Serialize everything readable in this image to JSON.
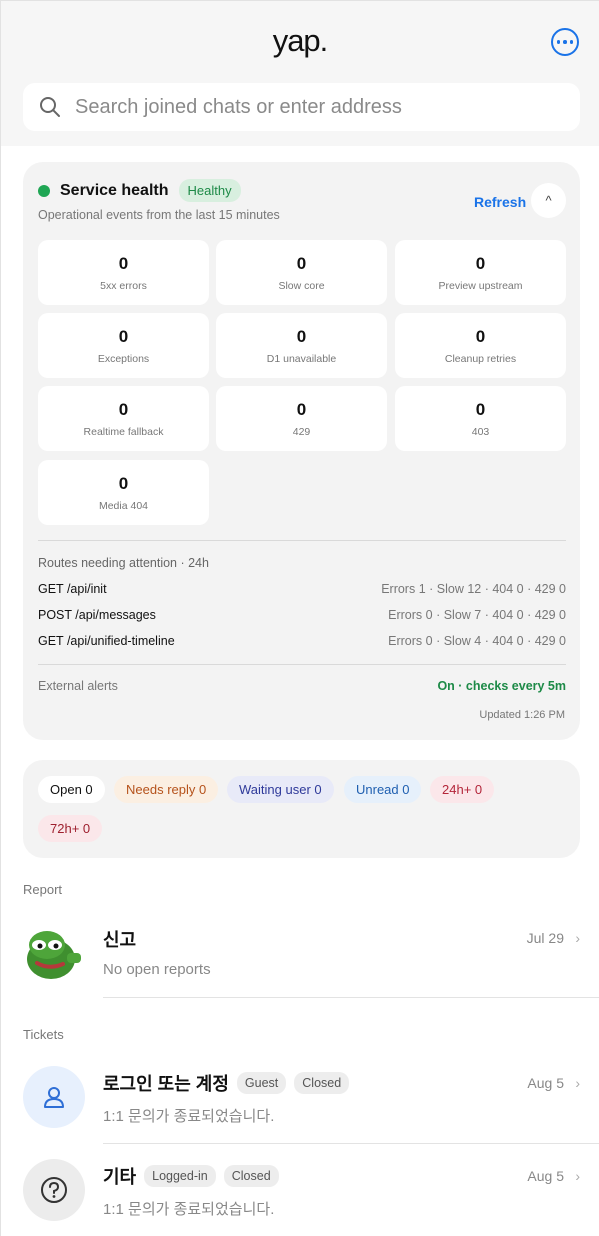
{
  "header": {
    "logo": "yap.",
    "search_placeholder": "Search joined chats or enter address"
  },
  "health": {
    "title": "Service health",
    "status_badge": "Healthy",
    "subtitle": "Operational events from the last 15 minutes",
    "refresh_label": "Refresh",
    "collapse_glyph": "^",
    "metrics": [
      {
        "value": "0",
        "label": "5xx errors"
      },
      {
        "value": "0",
        "label": "Slow core"
      },
      {
        "value": "0",
        "label": "Preview upstream"
      },
      {
        "value": "0",
        "label": "Exceptions"
      },
      {
        "value": "0",
        "label": "D1 unavailable"
      },
      {
        "value": "0",
        "label": "Cleanup retries"
      },
      {
        "value": "0",
        "label": "Realtime fallback"
      },
      {
        "value": "0",
        "label": "429"
      },
      {
        "value": "0",
        "label": "403"
      },
      {
        "value": "0",
        "label": "Media 404"
      }
    ],
    "routes_title": "Routes needing attention · 24h",
    "routes": [
      {
        "path": "GET /api/init",
        "stats": "Errors 1 · Slow 12 · 404 0 · 429 0"
      },
      {
        "path": "POST /api/messages",
        "stats": "Errors 0 · Slow 7 · 404 0 · 429 0"
      },
      {
        "path": "GET /api/unified-timeline",
        "stats": "Errors 0 · Slow 4 · 404 0 · 429 0"
      }
    ],
    "external_alerts_label": "External alerts",
    "external_alerts_status": "On · checks every 5m",
    "updated": "Updated 1:26 PM"
  },
  "filters": [
    {
      "label": "Open 0",
      "bg": "#ffffff",
      "fg": "#111111"
    },
    {
      "label": "Needs reply 0",
      "bg": "#fbefe2",
      "fg": "#b5521b"
    },
    {
      "label": "Waiting user 0",
      "bg": "#e8eaf8",
      "fg": "#2f3a9a"
    },
    {
      "label": "Unread 0",
      "bg": "#e6f0fb",
      "fg": "#1f5fb0"
    },
    {
      "label": "24h+ 0",
      "bg": "#fbe7ea",
      "fg": "#b3263a"
    },
    {
      "label": "72h+ 0",
      "bg": "#fbe7ea",
      "fg": "#9e1f2e"
    }
  ],
  "report_section": {
    "label": "Report",
    "item": {
      "title": "신고",
      "subtitle": "No open reports",
      "date": "Jul 29",
      "avatar_icon": "frog-avatar-icon"
    }
  },
  "tickets_section": {
    "label": "Tickets",
    "items": [
      {
        "title": "로그인 또는 계정",
        "tags": [
          "Guest",
          "Closed"
        ],
        "subtitle": "1:1 문의가 종료되었습니다.",
        "date": "Aug 5",
        "icon": "user-icon"
      },
      {
        "title": "기타",
        "tags": [
          "Logged-in",
          "Closed"
        ],
        "subtitle": "1:1 문의가 종료되었습니다.",
        "date": "Aug 5",
        "icon": "question-icon"
      }
    ]
  },
  "colors": {
    "accent": "#1a73e8",
    "healthy": "#1fa654"
  }
}
